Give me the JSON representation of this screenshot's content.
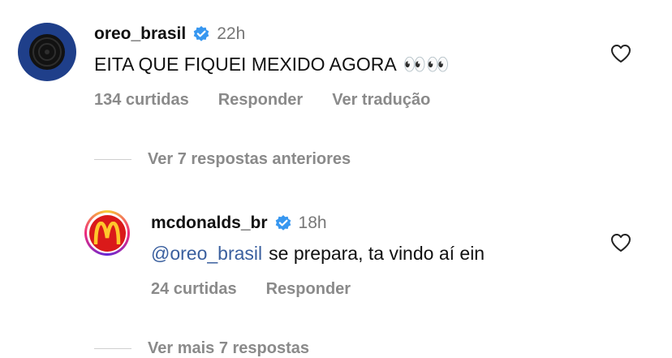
{
  "comments": [
    {
      "username": "oreo_brasil",
      "verified": true,
      "time": "22h",
      "text": "EITA QUE FIQUEI MEXIDO AGORA",
      "emoji": "👀👀",
      "likes": "134 curtidas",
      "reply_label": "Responder",
      "translate_label": "Ver tradução",
      "icons": {
        "avatar": "oreo-cookie-avatar",
        "verified": "verified-badge-icon",
        "like": "heart-icon"
      }
    },
    {
      "username": "mcdonalds_br",
      "verified": true,
      "time": "18h",
      "mention": "@oreo_brasil",
      "text": "se prepara, ta vindo aí ein",
      "likes": "24 curtidas",
      "reply_label": "Responder",
      "icons": {
        "avatar": "mcdonalds-logo-avatar",
        "verified": "verified-badge-icon",
        "like": "heart-icon"
      }
    }
  ],
  "threads": {
    "previous": "Ver 7 respostas anteriores",
    "more": "Ver mais 7 respostas"
  },
  "colors": {
    "verified": "#3797f0",
    "mention": "#3a5f9e",
    "meta": "#8a8a8a",
    "mc_red": "#da1a1a",
    "mc_yellow": "#ffc72c"
  }
}
